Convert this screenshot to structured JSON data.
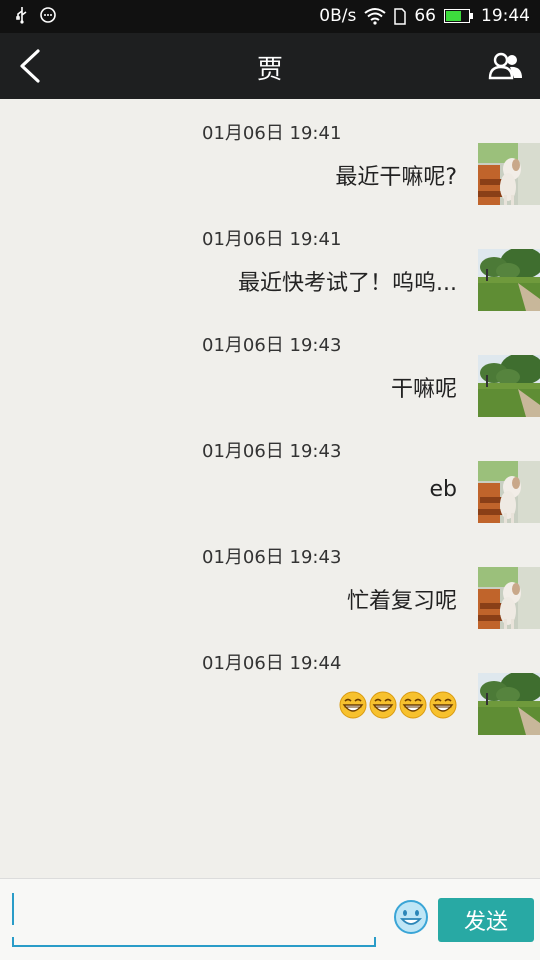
{
  "status_bar": {
    "speed": "0B/s",
    "battery_level": "66",
    "time": "19:44",
    "icons": [
      "usb-icon",
      "notification-icon",
      "wifi-icon",
      "sim-icon",
      "battery-icon"
    ]
  },
  "header": {
    "title": "贾",
    "back_icon": "back-arrow-icon",
    "contacts_icon": "contacts-icon"
  },
  "messages": [
    {
      "time": "01月06日 19:41",
      "text": "最近干嘛呢?",
      "avatar": "dog-photo"
    },
    {
      "time": "01月06日 19:41",
      "text": "最近快考试了！呜呜...",
      "avatar": "park-photo"
    },
    {
      "time": "01月06日 19:43",
      "text": "干嘛呢",
      "avatar": "park-photo"
    },
    {
      "time": "01月06日 19:43",
      "text": "eb",
      "avatar": "dog-photo"
    },
    {
      "time": "01月06日 19:43",
      "text": "忙着复习呢",
      "avatar": "dog-photo"
    },
    {
      "time": "01月06日 19:44",
      "emojis": [
        "grin-emoji",
        "grin-emoji",
        "grin-emoji",
        "grin-emoji"
      ],
      "avatar": "park-photo"
    }
  ],
  "input": {
    "value": "",
    "placeholder": "",
    "send_label": "发送",
    "emoji_icon": "smiley-icon"
  },
  "colors": {
    "header_bg": "#1e1f20",
    "chat_bg": "#f0efeb",
    "send_button": "#28a9a4",
    "input_accent": "#2a9cc8"
  }
}
